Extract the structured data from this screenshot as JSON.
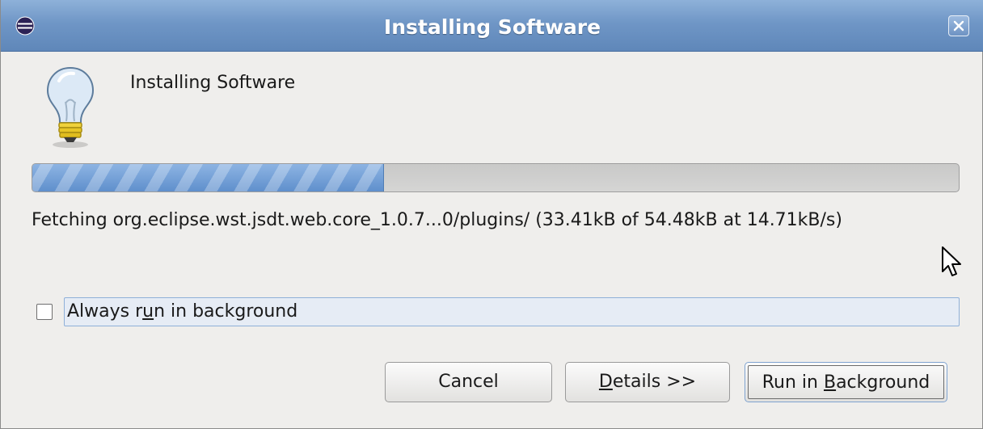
{
  "window": {
    "title": "Installing Software",
    "heading": "Installing Software"
  },
  "icons": {
    "app": "eclipse-icon",
    "close": "close-icon",
    "info": "lightbulb-icon",
    "pointer": "mouse-cursor-icon"
  },
  "progress": {
    "fraction": 0.38,
    "status": "Fetching org.eclipse.wst.jsdt.web.core_1.0.7...0/plugins/ (33.41kB of 54.48kB at 14.71kB/s)"
  },
  "options": {
    "always_run_background": {
      "label_pre": "Always r",
      "label_mnemonic": "u",
      "label_post": "n in background",
      "checked": false
    }
  },
  "buttons": {
    "cancel": "Cancel",
    "details_mnemonic": "D",
    "details_rest": "etails >>",
    "run_bg_pre": "Run in ",
    "run_bg_mnemonic": "B",
    "run_bg_post": "ackground"
  },
  "colors": {
    "titlebar": "#6f96c6",
    "progress_fill": "#5f8fcc",
    "focus_row": "#e6ecf5"
  }
}
